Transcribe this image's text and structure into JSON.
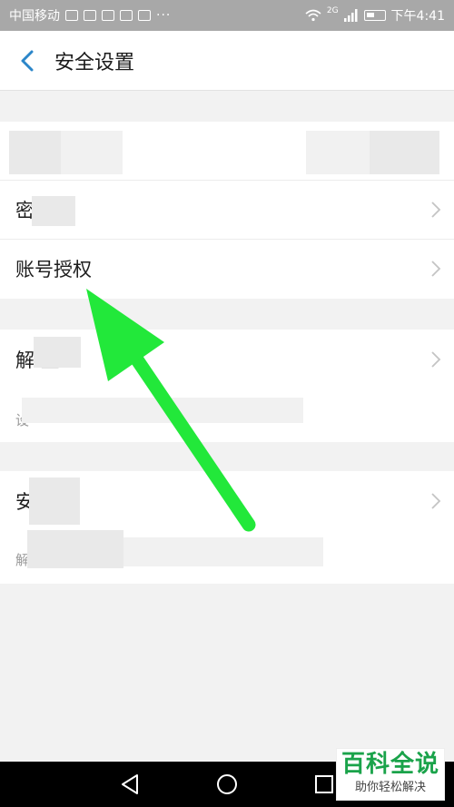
{
  "status_bar": {
    "carrier": "中国移动",
    "network": "2G",
    "time": "下午4:41"
  },
  "header": {
    "title": "安全设置"
  },
  "sections": {
    "account_card": {
      "password_row": "密 置",
      "auth_row": "账号授权"
    },
    "unlock_card": {
      "unlock_row": "解 置",
      "unlock_sub": "设"
    },
    "security_card": {
      "security_row": "安 心",
      "security_sub": "解"
    }
  },
  "watermark": {
    "main": "百科全说",
    "sub": "助你轻松解决"
  },
  "colors": {
    "status_bar": "#a8a8a8",
    "accent": "#2b86c9",
    "arrow": "#22e83a",
    "watermark": "#1aa34a"
  },
  "icons": [
    "back-icon",
    "chevron-right-icon",
    "wifi-icon",
    "signal-icon",
    "battery-icon",
    "nav-back-icon",
    "nav-home-icon",
    "nav-recents-icon"
  ]
}
